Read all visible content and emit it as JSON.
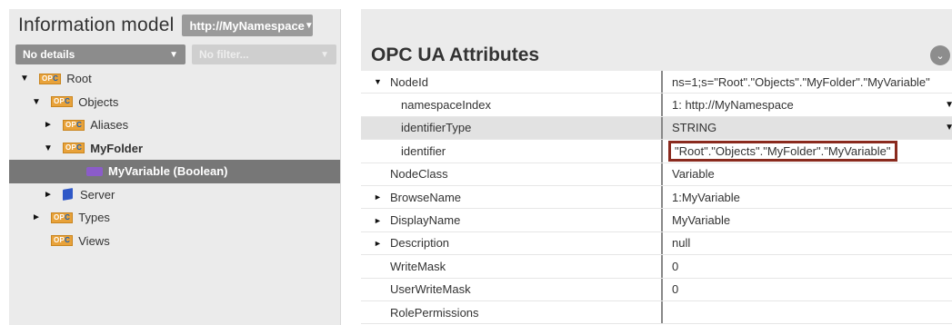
{
  "left": {
    "title": "Information model",
    "namespace_select": "http://MyNamespace",
    "details_select": "No details",
    "filter_select": "No filter...",
    "tree": [
      {
        "label": "Root",
        "toggle": "▼",
        "icon": "opc-icon",
        "indent": 0
      },
      {
        "label": "Objects",
        "toggle": "▼",
        "icon": "opc-icon",
        "indent": 1
      },
      {
        "label": "Aliases",
        "toggle": "►",
        "icon": "opc-icon",
        "indent": 2
      },
      {
        "label": "MyFolder",
        "toggle": "▼",
        "icon": "opc-icon",
        "indent": 2,
        "bold": true
      },
      {
        "label": "MyVariable (Boolean)",
        "toggle": "",
        "icon": "variable-icon",
        "indent": 4,
        "selected": true
      },
      {
        "label": "Server",
        "toggle": "►",
        "icon": "server-icon",
        "indent": 2
      },
      {
        "label": "Types",
        "toggle": "►",
        "icon": "opc-icon",
        "indent": 1
      },
      {
        "label": "Views",
        "toggle": "",
        "icon": "opc-icon",
        "indent": 1
      }
    ]
  },
  "right": {
    "title": "OPC UA Attributes",
    "attributes": [
      {
        "name": "NodeId",
        "toggle": "▼",
        "value": "ns=1;s=\"Root\".\"Objects\".\"MyFolder\".\"MyVariable\"",
        "level": 0
      },
      {
        "name": "namespaceIndex",
        "toggle": "",
        "value": "1: http://MyNamespace",
        "level": 1,
        "dropdown": true
      },
      {
        "name": "identifierType",
        "toggle": "",
        "value": "STRING",
        "level": 1,
        "dropdown": true,
        "shaded": true
      },
      {
        "name": "identifier",
        "toggle": "",
        "value": "\"Root\".\"Objects\".\"MyFolder\".\"MyVariable\"",
        "level": 1,
        "highlight": true
      },
      {
        "name": "NodeClass",
        "toggle": "",
        "value": "Variable",
        "level": 0
      },
      {
        "name": "BrowseName",
        "toggle": "►",
        "value": "1:MyVariable",
        "level": 0
      },
      {
        "name": "DisplayName",
        "toggle": "►",
        "value": "MyVariable",
        "level": 0
      },
      {
        "name": "Description",
        "toggle": "►",
        "value": "null",
        "level": 0
      },
      {
        "name": "WriteMask",
        "toggle": "",
        "value": "0",
        "level": 0
      },
      {
        "name": "UserWriteMask",
        "toggle": "",
        "value": "0",
        "level": 0
      },
      {
        "name": "RolePermissions",
        "toggle": "",
        "value": "",
        "level": 0
      }
    ]
  },
  "colors": {
    "highlight_border": "#8a2a1e",
    "selected_row": "#777777",
    "opc_icon": "#e8a23a",
    "variable_icon": "#8b5cc9",
    "server_icon": "#2f58c7"
  }
}
